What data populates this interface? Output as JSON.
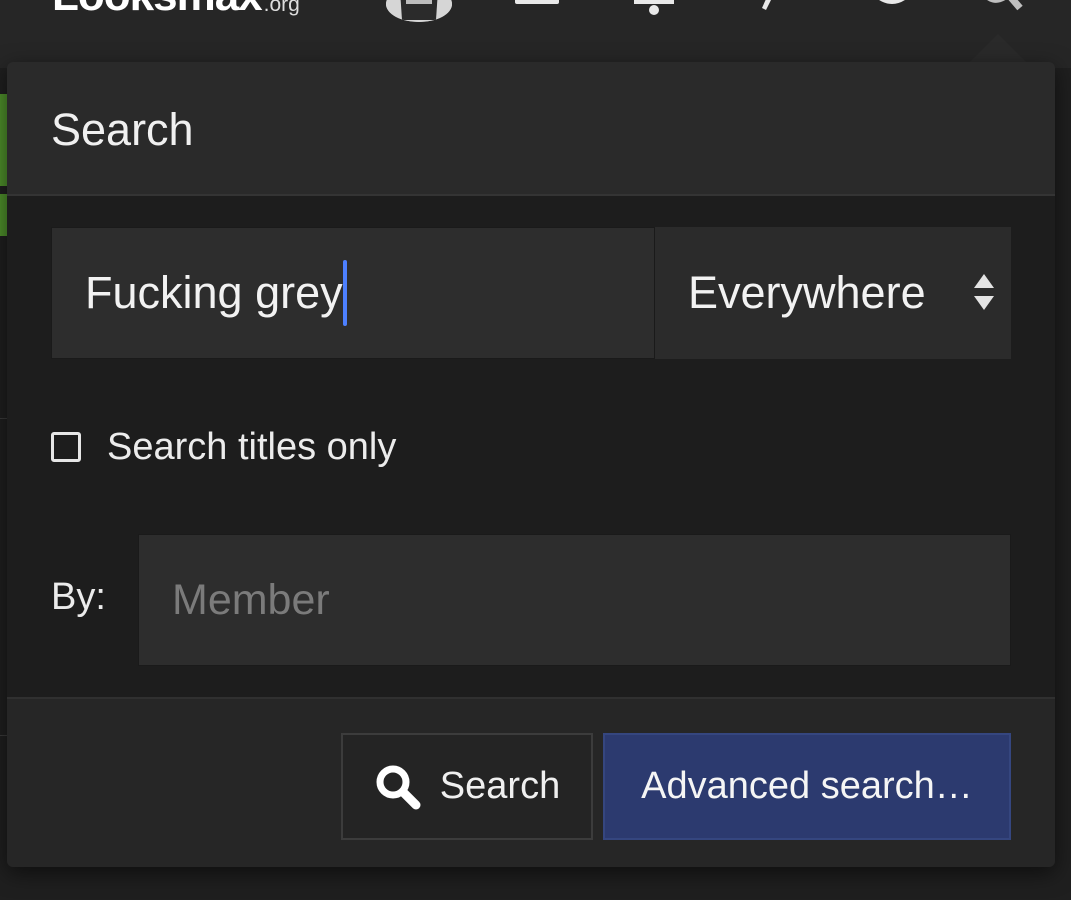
{
  "site": {
    "logo_main": "Looksmax",
    "logo_tld": ".org"
  },
  "search_menu": {
    "title": "Search",
    "query_value": "Fucking grey",
    "scope_selected": "Everywhere",
    "titles_only_label": "Search titles only",
    "titles_only_checked": false,
    "by_label": "By:",
    "member_placeholder": "Member",
    "search_button_label": "Search",
    "advanced_button_label": "Advanced search…"
  },
  "colors": {
    "accent_blue": "#2c3a6f",
    "caret_blue": "#4d80ff",
    "background_green": "#4e8f2b"
  },
  "icons": {
    "search": "magnifier-icon",
    "select": "up-down-arrows-icon"
  }
}
